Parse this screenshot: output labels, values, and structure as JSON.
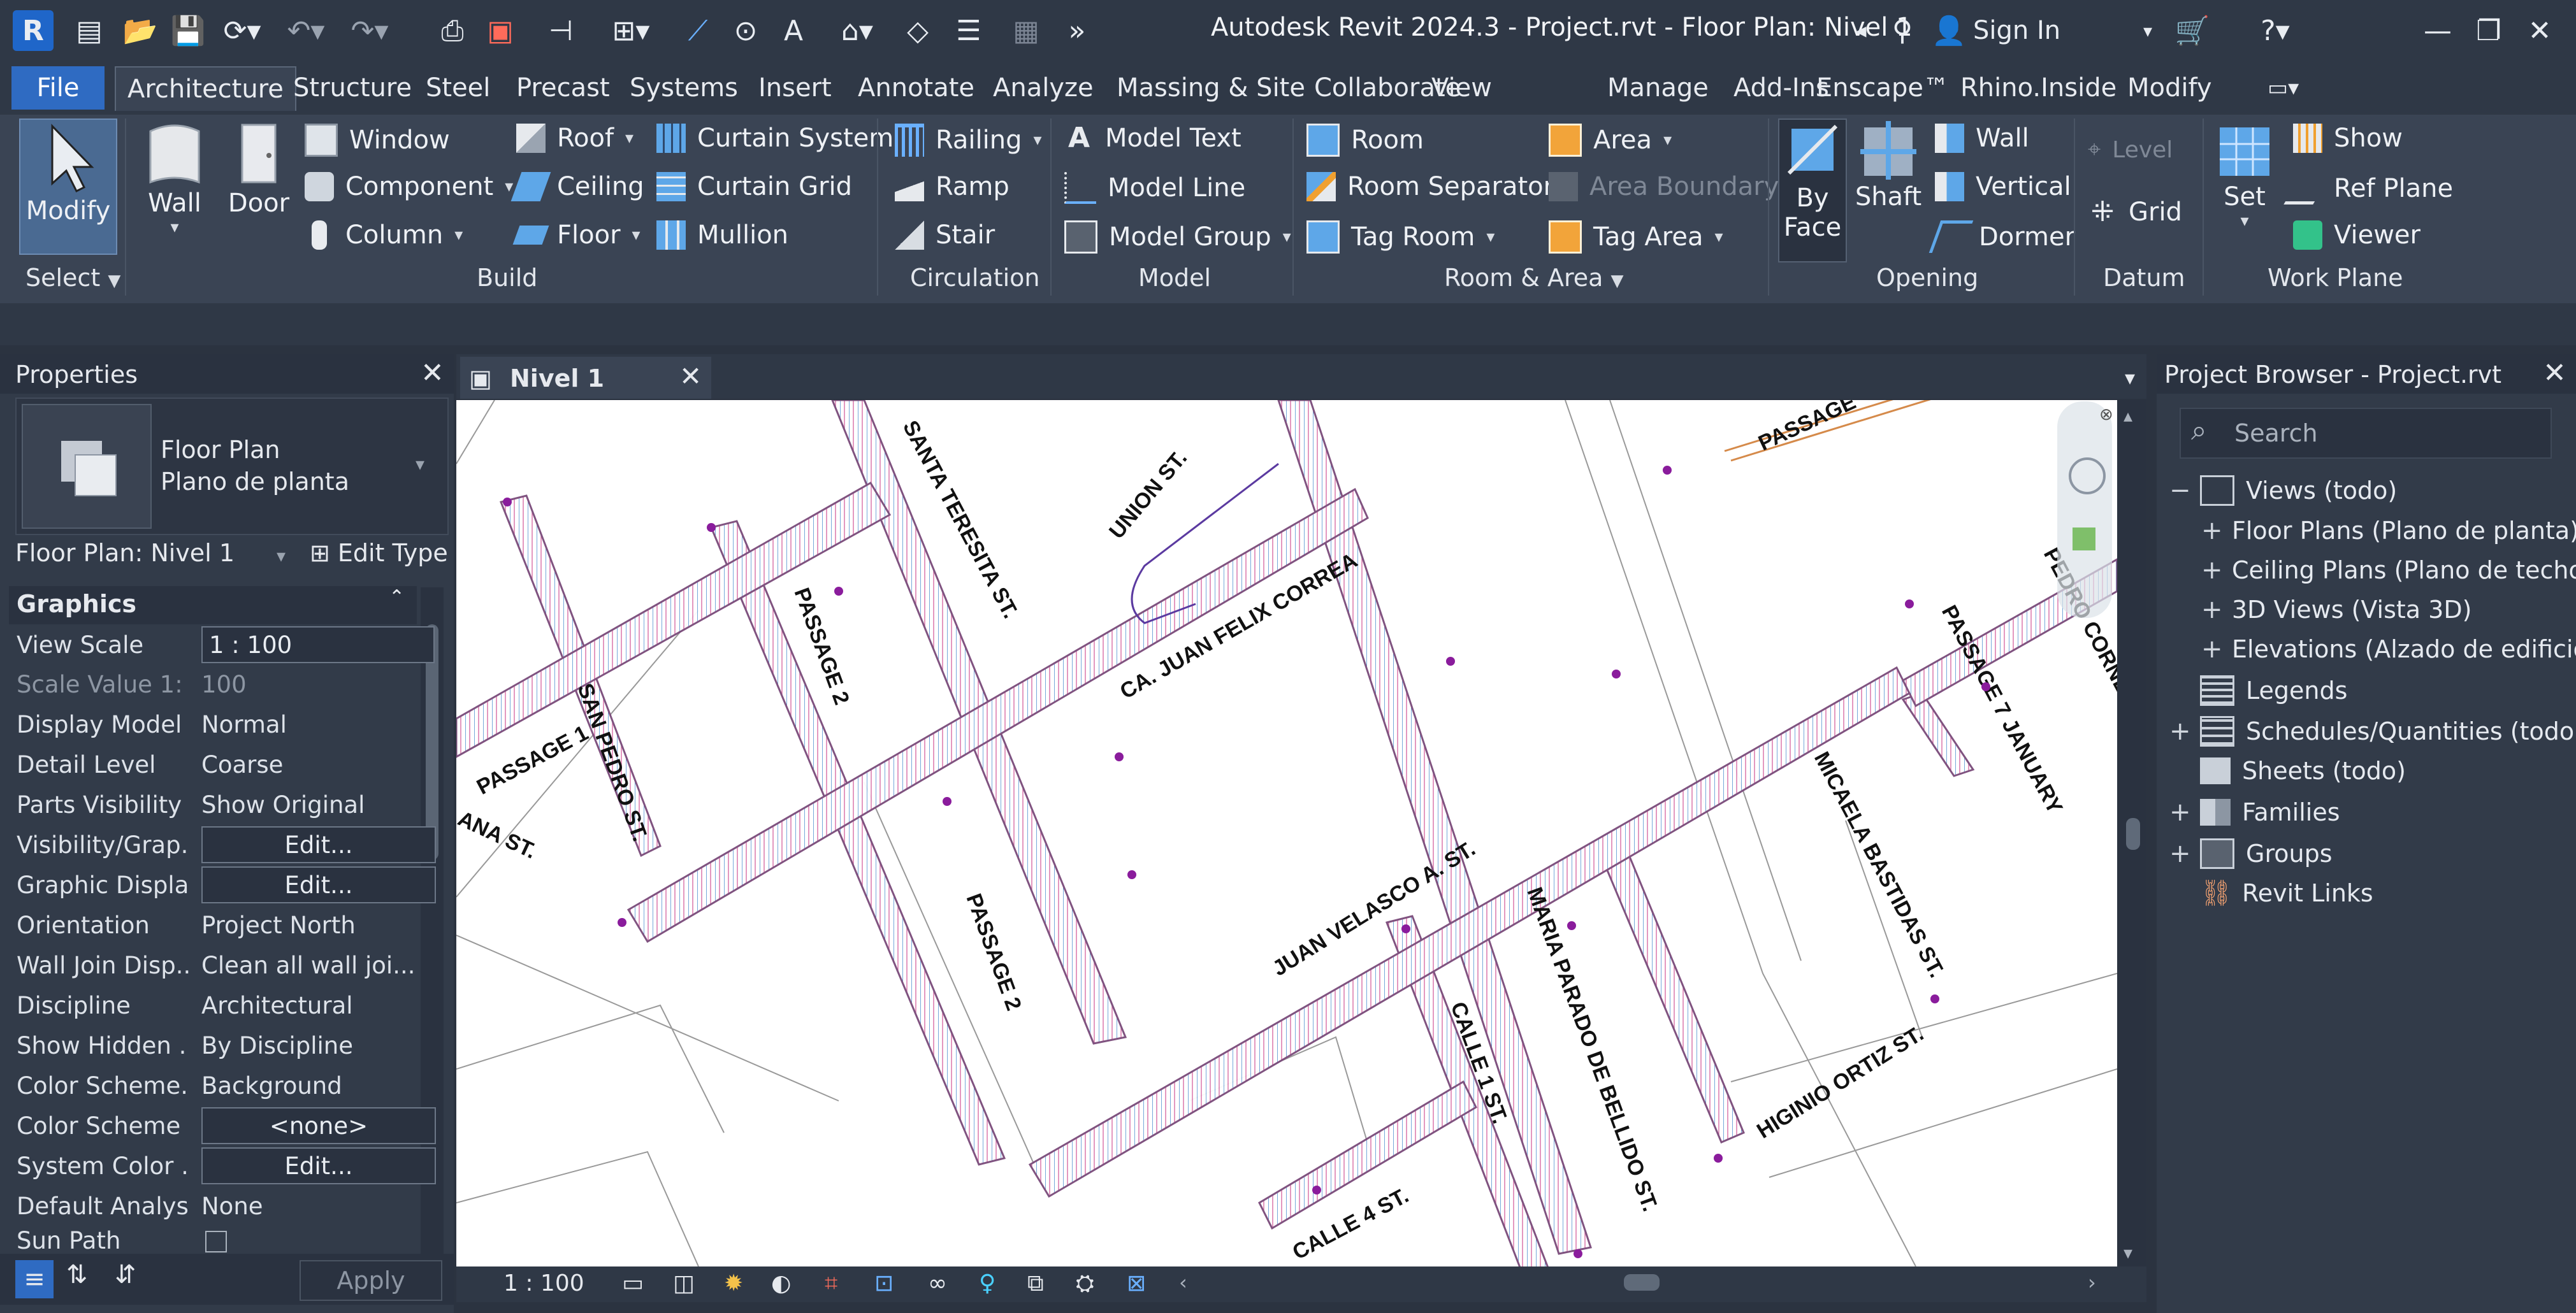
{
  "app": {
    "title": "Autodesk Revit 2024.3 - Project.rvt - Floor Plan: Nivel 1",
    "logo_letter": "R",
    "sign_in": "Sign In"
  },
  "tabs": [
    "File",
    "Architecture",
    "Structure",
    "Steel",
    "Precast",
    "Systems",
    "Insert",
    "Annotate",
    "Analyze",
    "Massing & Site",
    "Collaborate",
    "View",
    "Manage",
    "Add-Ins",
    "Enscape™",
    "Rhino.Inside",
    "Modify"
  ],
  "ribbon": {
    "select": {
      "modify": "Modify",
      "label": "Select"
    },
    "build": {
      "label": "Build",
      "wall": "Wall",
      "door": "Door",
      "window": "Window",
      "component": "Component",
      "column": "Column",
      "roof": "Roof",
      "ceiling": "Ceiling",
      "floor": "Floor",
      "curtain_system": "Curtain  System",
      "curtain_grid": "Curtain  Grid",
      "mullion": "Mullion"
    },
    "circulation": {
      "label": "Circulation",
      "railing": "Railing",
      "ramp": "Ramp",
      "stair": "Stair"
    },
    "model": {
      "label": "Model",
      "model_text": "Model  Text",
      "model_line": "Model  Line",
      "model_group": "Model  Group"
    },
    "room_area": {
      "label": "Room & Area",
      "room": "Room",
      "room_separator": "Room  Separator",
      "tag_room": "Tag  Room",
      "area": "Area",
      "area_boundary": "Area  Boundary",
      "tag_area": "Tag  Area"
    },
    "opening": {
      "label": "Opening",
      "by_face": "By Face",
      "shaft": "Shaft",
      "wall": "Wall",
      "vertical": "Vertical",
      "dormer": "Dormer"
    },
    "datum": {
      "label": "Datum",
      "level": "Level",
      "grid": "Grid"
    },
    "work_plane": {
      "label": "Work Plane",
      "set": "Set",
      "show": "Show",
      "ref_plane": "Ref  Plane",
      "viewer": "Viewer"
    }
  },
  "properties": {
    "title": "Properties",
    "type_line1": "Floor Plan",
    "type_line2": "Plano de planta",
    "instance": "Floor Plan: Nivel 1",
    "edit_type": "Edit Type",
    "section": "Graphics",
    "rows": [
      {
        "k": "View Scale",
        "v": "1 : 100"
      },
      {
        "k": "Scale Value    1:",
        "v": "100"
      },
      {
        "k": "Display Model",
        "v": "Normal"
      },
      {
        "k": "Detail Level",
        "v": "Coarse"
      },
      {
        "k": "Parts Visibility",
        "v": "Show Original"
      },
      {
        "k": "Visibility/Grap...",
        "v": "Edit..."
      },
      {
        "k": "Graphic Displa...",
        "v": "Edit..."
      },
      {
        "k": "Orientation",
        "v": "Project North"
      },
      {
        "k": "Wall Join Disp...",
        "v": "Clean all wall joi..."
      },
      {
        "k": "Discipline",
        "v": "Architectural"
      },
      {
        "k": "Show Hidden ...",
        "v": "By Discipline"
      },
      {
        "k": "Color Scheme...",
        "v": "Background"
      },
      {
        "k": "Color Scheme",
        "v": "<none>"
      },
      {
        "k": "System Color ...",
        "v": "Edit..."
      },
      {
        "k": "Default Analys...",
        "v": "None"
      },
      {
        "k": "Sun Path",
        "v": ""
      }
    ],
    "apply": "Apply"
  },
  "view": {
    "tab": "Nivel 1",
    "scale": "1 : 100",
    "streets": [
      "SANTA TERESITA ST.",
      "UNION ST.",
      "PASSAGE",
      "PASSAGE 2",
      "CA. JUAN FELIX CORREA",
      "PASSAGE 1",
      "SAN PEDRO ST.",
      "ANA ST.",
      "PASSAGE 2",
      "JUAN VELASCO A. ST.",
      "MARIA PARADO DE BELLIDO ST.",
      "CALLE 1 ST.",
      "CALLE 4 ST.",
      "HIGINIO ORTIZ ST.",
      "MICAELA BASTIDAS ST.",
      "PASSAGE 7 JANUARY",
      "PEDRO CORNE"
    ]
  },
  "browser": {
    "title": "Project Browser - Project.rvt",
    "search_placeholder": "Search",
    "items": [
      "Views (todo)",
      "Floor Plans (Plano de planta)",
      "Ceiling Plans (Plano de techo)",
      "3D Views (Vista 3D)",
      "Elevations (Alzado de edificio)",
      "Legends",
      "Schedules/Quantities (todo)",
      "Sheets (todo)",
      "Families",
      "Groups",
      "Revit Links"
    ]
  }
}
